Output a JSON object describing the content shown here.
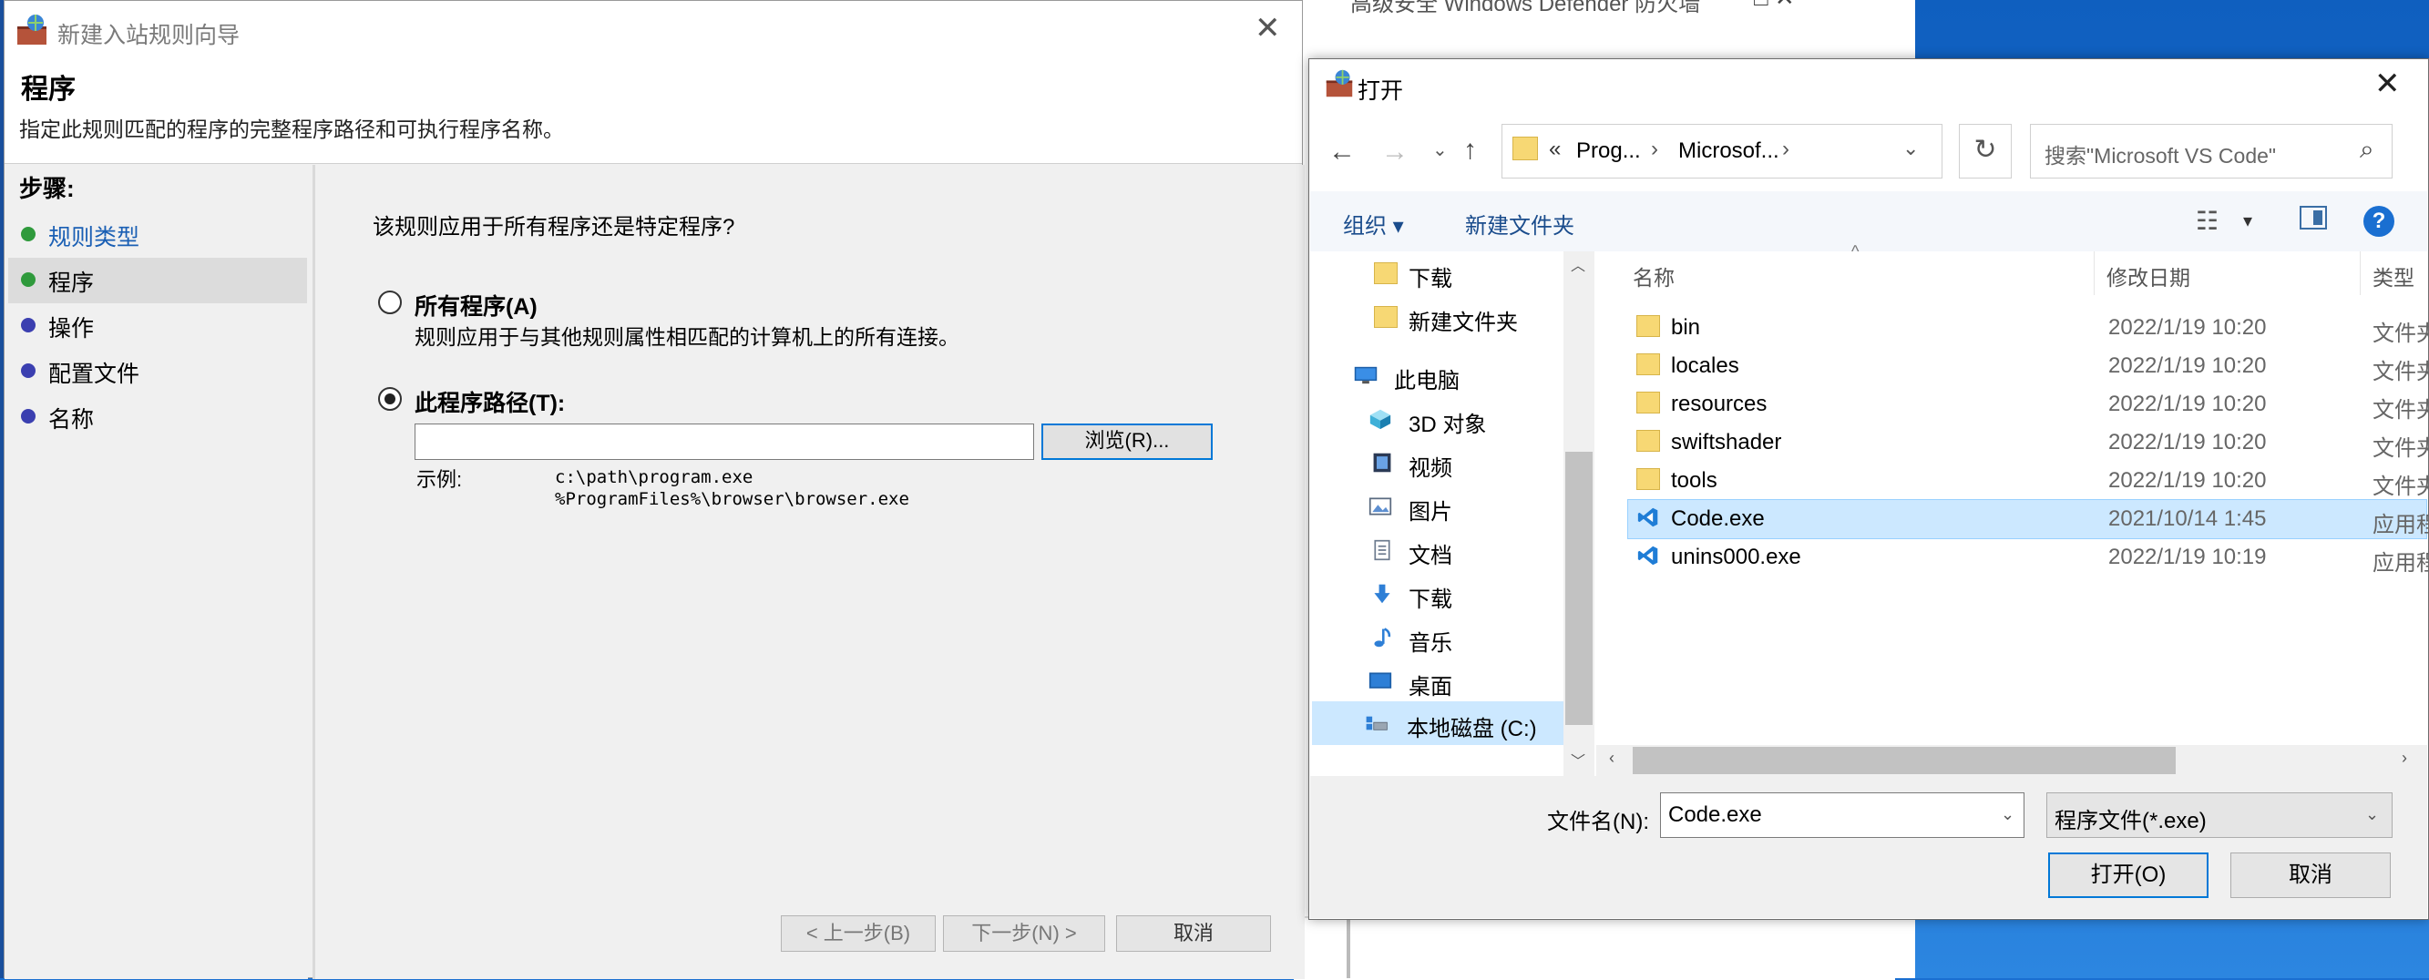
{
  "background_window": {
    "title": "高级安全 Windows Defender 防火墙",
    "controls": "□   ✕"
  },
  "wizard": {
    "title": "新建入站规则向导",
    "close": "✕",
    "heading": "程序",
    "description": "指定此规则匹配的程序的完整程序路径和可执行程序名称。",
    "steps_label": "步骤:",
    "steps": [
      {
        "label": "规则类型",
        "color": "#2f9a3c",
        "link": true
      },
      {
        "label": "程序",
        "color": "#2f9a3c",
        "link": false
      },
      {
        "label": "操作",
        "color": "#3b3fb0",
        "link": false
      },
      {
        "label": "配置文件",
        "color": "#3b3fb0",
        "link": false
      },
      {
        "label": "名称",
        "color": "#3b3fb0",
        "link": false
      }
    ],
    "question": "该规则应用于所有程序还是特定程序?",
    "option_all": {
      "label": "所有程序(A)",
      "desc": "规则应用于与其他规则属性相匹配的计算机上的所有连接。",
      "checked": false
    },
    "option_path": {
      "label": "此程序路径(T):",
      "checked": true
    },
    "path_value": "",
    "browse": "浏览(R)...",
    "example_label": "示例:",
    "example_line1": "c:\\path\\program.exe",
    "example_line2": "%ProgramFiles%\\browser\\browser.exe",
    "back": "< 上一步(B)",
    "next": "下一步(N) >",
    "cancel": "取消"
  },
  "dialog": {
    "title": "打开",
    "close": "✕",
    "address": {
      "chevrons": "«",
      "seg1": "Prog...",
      "sep": "›",
      "seg2": "Microsof...",
      "sep2": "›"
    },
    "search_placeholder": "搜索\"Microsoft VS Code\"",
    "organize": "组织 ▾",
    "new_folder": "新建文件夹",
    "help": "?",
    "nav_items": [
      {
        "label": "下载",
        "icon": "folder-icon"
      },
      {
        "label": "新建文件夹",
        "icon": "folder-icon"
      },
      {
        "label": "此电脑",
        "icon": "computer-icon"
      },
      {
        "label": "3D 对象",
        "icon": "cube-icon"
      },
      {
        "label": "视频",
        "icon": "video-icon"
      },
      {
        "label": "图片",
        "icon": "picture-icon"
      },
      {
        "label": "文档",
        "icon": "document-icon"
      },
      {
        "label": "下载",
        "icon": "download-icon"
      },
      {
        "label": "音乐",
        "icon": "music-icon"
      },
      {
        "label": "桌面",
        "icon": "desktop-icon"
      },
      {
        "label": "本地磁盘 (C:)",
        "icon": "drive-icon"
      }
    ],
    "columns": {
      "name": "名称",
      "date": "修改日期",
      "type": "类型"
    },
    "files": [
      {
        "name": "bin",
        "date": "2022/1/19 10:20",
        "type": "文件夹",
        "icon": "folder-icon"
      },
      {
        "name": "locales",
        "date": "2022/1/19 10:20",
        "type": "文件夹",
        "icon": "folder-icon"
      },
      {
        "name": "resources",
        "date": "2022/1/19 10:20",
        "type": "文件夹",
        "icon": "folder-icon"
      },
      {
        "name": "swiftshader",
        "date": "2022/1/19 10:20",
        "type": "文件夹",
        "icon": "folder-icon"
      },
      {
        "name": "tools",
        "date": "2022/1/19 10:20",
        "type": "文件夹",
        "icon": "folder-icon"
      },
      {
        "name": "Code.exe",
        "date": "2021/10/14 1:45",
        "type": "应用程序",
        "icon": "vscode-icon"
      },
      {
        "name": "unins000.exe",
        "date": "2022/1/19 10:19",
        "type": "应用程序",
        "icon": "vscode-icon"
      }
    ],
    "filename_label": "文件名(N):",
    "filename_value": "Code.exe",
    "filter": "程序文件(*.exe)",
    "open": "打开(O)",
    "cancel": "取消"
  }
}
